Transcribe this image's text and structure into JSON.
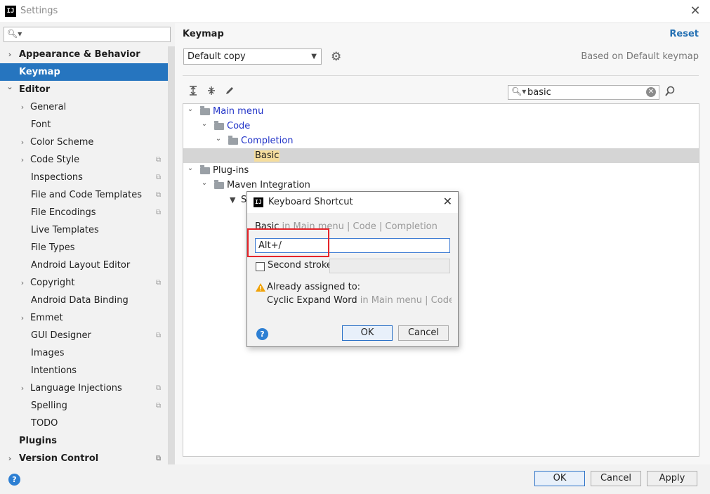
{
  "window": {
    "title": "Settings",
    "app_icon": "IJ",
    "close_label": "✕"
  },
  "sidebar": {
    "search_placeholder": "",
    "items": [
      {
        "label": "Appearance & Behavior",
        "level": 0,
        "chevron": "›",
        "bold": true
      },
      {
        "label": "Keymap",
        "level": 0,
        "chevron": "",
        "bold": true,
        "selected": true
      },
      {
        "label": "Editor",
        "level": 0,
        "chevron": "⌄",
        "bold": true
      },
      {
        "label": "General",
        "level": 1,
        "chevron": "›"
      },
      {
        "label": "Font",
        "level": 1,
        "chevron": ""
      },
      {
        "label": "Color Scheme",
        "level": 1,
        "chevron": "›"
      },
      {
        "label": "Code Style",
        "level": 1,
        "chevron": "›",
        "copy": true
      },
      {
        "label": "Inspections",
        "level": 1,
        "chevron": "",
        "copy": true
      },
      {
        "label": "File and Code Templates",
        "level": 1,
        "chevron": "",
        "copy": true
      },
      {
        "label": "File Encodings",
        "level": 1,
        "chevron": "",
        "copy": true
      },
      {
        "label": "Live Templates",
        "level": 1,
        "chevron": ""
      },
      {
        "label": "File Types",
        "level": 1,
        "chevron": ""
      },
      {
        "label": "Android Layout Editor",
        "level": 1,
        "chevron": ""
      },
      {
        "label": "Copyright",
        "level": 1,
        "chevron": "›",
        "copy": true
      },
      {
        "label": "Android Data Binding",
        "level": 1,
        "chevron": ""
      },
      {
        "label": "Emmet",
        "level": 1,
        "chevron": "›"
      },
      {
        "label": "GUI Designer",
        "level": 1,
        "chevron": "",
        "copy": true
      },
      {
        "label": "Images",
        "level": 1,
        "chevron": ""
      },
      {
        "label": "Intentions",
        "level": 1,
        "chevron": ""
      },
      {
        "label": "Language Injections",
        "level": 1,
        "chevron": "›",
        "copy": true
      },
      {
        "label": "Spelling",
        "level": 1,
        "chevron": "",
        "copy": true
      },
      {
        "label": "TODO",
        "level": 1,
        "chevron": ""
      },
      {
        "label": "Plugins",
        "level": 0,
        "chevron": "",
        "bold": true
      },
      {
        "label": "Version Control",
        "level": 0,
        "chevron": "›",
        "bold": true,
        "copy": true
      }
    ]
  },
  "main": {
    "heading": "Keymap",
    "reset_label": "Reset",
    "keymap_scheme": "Default copy",
    "based_on": "Based on Default keymap",
    "filter_value": "basic",
    "tree": [
      {
        "label": "Main menu",
        "level": 0,
        "chevron": "⌄",
        "folder": true,
        "color": "blue"
      },
      {
        "label": "Code",
        "level": 1,
        "chevron": "⌄",
        "folder": true,
        "color": "blue"
      },
      {
        "label": "Completion",
        "level": 2,
        "chevron": "⌄",
        "folder": true,
        "color": "blue"
      },
      {
        "label": "Basic",
        "level": 3,
        "chevron": "",
        "folder": false,
        "highlight": true,
        "selected": true
      },
      {
        "label": "Plug-ins",
        "level": 0,
        "chevron": "⌄",
        "folder": true
      },
      {
        "label": "Maven Integration",
        "level": 1,
        "chevron": "⌄",
        "folder": true
      },
      {
        "label": "S",
        "level": 2,
        "chevron": "",
        "folder": false,
        "filter_icon": true
      }
    ]
  },
  "dialog": {
    "title": "Keyboard Shortcut",
    "app_icon": "IJ",
    "close_label": "✕",
    "path_action": "Basic",
    "path_rest": " in Main menu | Code | Completion",
    "shortcut_value": "Alt+/",
    "second_stroke_label": "Second stroke:",
    "assigned_label": "Already assigned to:",
    "conflict_action": "Cyclic Expand Word",
    "conflict_path": " in Main menu | Code | Co",
    "ok_label": "OK",
    "cancel_label": "Cancel",
    "help_label": "?"
  },
  "footer": {
    "help_label": "?",
    "ok_label": "OK",
    "cancel_label": "Cancel",
    "apply_label": "Apply"
  },
  "colors": {
    "selection": "#2675bf",
    "link": "#2470b3",
    "tree_blue": "#2234c8",
    "highlight": "#f5dd9c",
    "annotation": "#e5242a"
  }
}
